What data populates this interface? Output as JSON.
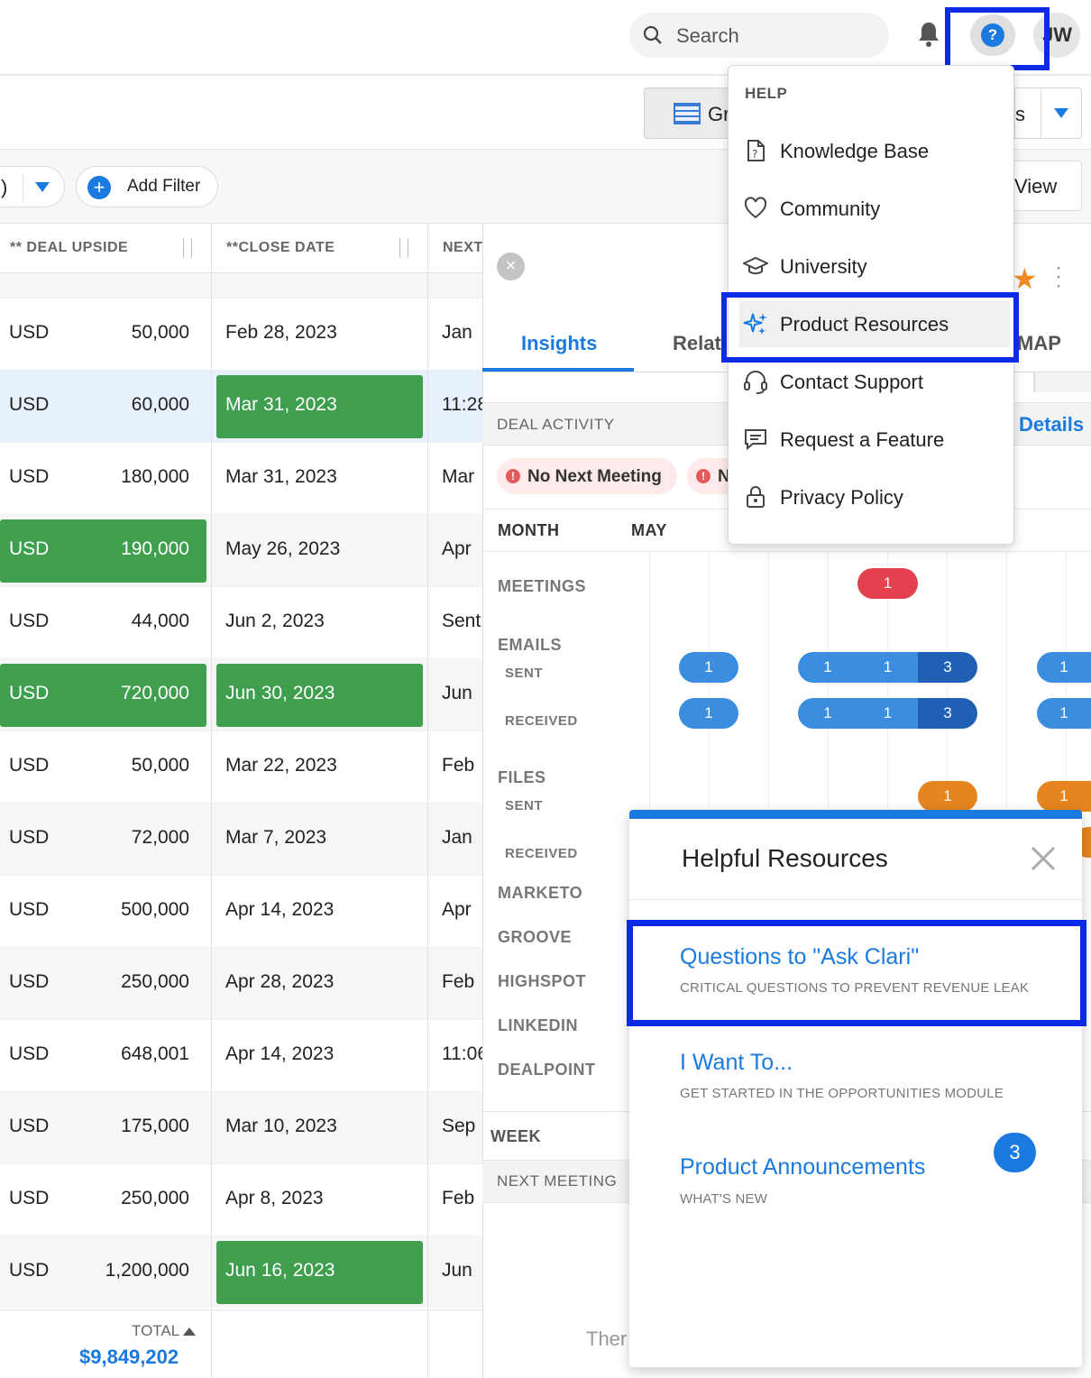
{
  "header": {
    "search_placeholder": "Search",
    "help_icon": "?",
    "avatar_initials": "JW"
  },
  "toolbar": {
    "grid_label": "Gr",
    "right_dropdown_label": "s",
    "view_label": "View"
  },
  "filters": {
    "pill_label": ")",
    "add_filter": "Add Filter"
  },
  "grid": {
    "col_upside": "** DEAL UPSIDE",
    "col_close": "**CLOSE DATE",
    "col_next": "NEXT",
    "rows": [
      {
        "cur": "USD",
        "amt": "50,000",
        "date": "Feb 28, 2023",
        "next": "Jan"
      },
      {
        "cur": "USD",
        "amt": "60,000",
        "date": "Mar 31, 2023",
        "next": "11:28"
      },
      {
        "cur": "USD",
        "amt": "180,000",
        "date": "Mar 31, 2023",
        "next": "Mar"
      },
      {
        "cur": "USD",
        "amt": "190,000",
        "date": "May 26, 2023",
        "next": "Apr"
      },
      {
        "cur": "USD",
        "amt": "44,000",
        "date": "Jun 2, 2023",
        "next": "Sent"
      },
      {
        "cur": "USD",
        "amt": "720,000",
        "date": "Jun 30, 2023",
        "next": "Jun"
      },
      {
        "cur": "USD",
        "amt": "50,000",
        "date": "Mar 22, 2023",
        "next": "Feb"
      },
      {
        "cur": "USD",
        "amt": "72,000",
        "date": "Mar 7, 2023",
        "next": "Jan"
      },
      {
        "cur": "USD",
        "amt": "500,000",
        "date": "Apr 14, 2023",
        "next": "Apr"
      },
      {
        "cur": "USD",
        "amt": "250,000",
        "date": "Apr 28, 2023",
        "next": "Feb"
      },
      {
        "cur": "USD",
        "amt": "648,001",
        "date": "Apr 14, 2023",
        "next": "11:06"
      },
      {
        "cur": "USD",
        "amt": "175,000",
        "date": "Mar 10, 2023",
        "next": "Sep"
      },
      {
        "cur": "USD",
        "amt": "250,000",
        "date": "Apr 8, 2023",
        "next": "Feb"
      },
      {
        "cur": "USD",
        "amt": "1,200,000",
        "date": "Jun 16, 2023",
        "next": "Jun"
      }
    ],
    "total_label": "TOTAL",
    "total_value": "$9,849,202"
  },
  "panel": {
    "tab_insights": "Insights",
    "tab_rel": "Relati",
    "tab_map": "MAP",
    "deal_activity": "DEAL ACTIVITY",
    "details": "Details",
    "pill_no_meeting": "No Next Meeting",
    "pill_n": "N",
    "month": "MONTH",
    "may": "MAY",
    "meetings": "MEETINGS",
    "emails": "EMAILS",
    "sent": "SENT",
    "received": "RECEIVED",
    "files": "FILES",
    "files_sent": "SENT",
    "files_received": "RECEIVED",
    "marketo": "MARKETO",
    "groove": "GROOVE",
    "highspot": "HIGHSPOT",
    "linkedin": "LINKEDIN",
    "dealpoint": "DEALPOINT",
    "week": "WEEK",
    "next_meeting": "NEXT MEETING",
    "there": "Ther",
    "bubbles": {
      "meet": "1",
      "s1": "1",
      "s2": "1",
      "s3": "1",
      "s4": "3",
      "s5": "1",
      "r1": "1",
      "r2": "1",
      "r3": "1",
      "r4": "3",
      "r5": "1",
      "f1": "1",
      "f2": "1"
    }
  },
  "help_menu": {
    "title": "HELP",
    "items": [
      {
        "label": "Knowledge Base"
      },
      {
        "label": "Community"
      },
      {
        "label": "University"
      },
      {
        "label": "Product Resources"
      },
      {
        "label": "Contact Support"
      },
      {
        "label": "Request a Feature"
      },
      {
        "label": "Privacy Policy"
      }
    ]
  },
  "helpful_resources": {
    "title": "Helpful Resources",
    "items": [
      {
        "title": "Questions to \"Ask Clari\"",
        "subtitle": "CRITICAL QUESTIONS TO PREVENT REVENUE LEAK"
      },
      {
        "title": "I Want To...",
        "subtitle": "GET STARTED IN THE OPPORTUNITIES MODULE"
      },
      {
        "title": "Product Announcements",
        "subtitle": "WHAT'S NEW"
      }
    ],
    "badge": "3"
  },
  "colors": {
    "accent": "#1a7ae0",
    "highlight_outline": "#0c2be6",
    "green": "#3f9f4f",
    "star": "#ef8c23"
  }
}
